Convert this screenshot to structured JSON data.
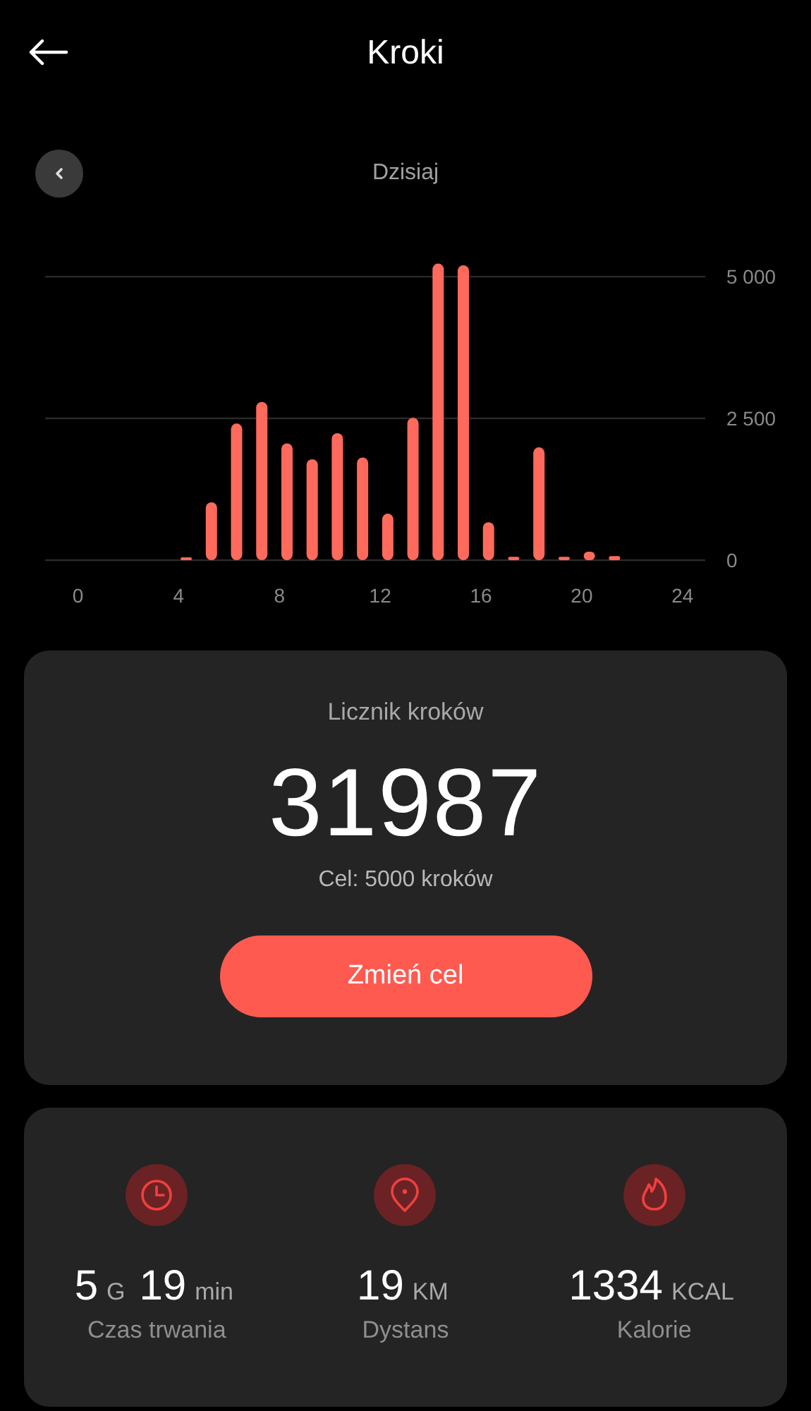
{
  "header": {
    "title": "Kroki"
  },
  "period": {
    "label": "Dzisiaj"
  },
  "chart_data": {
    "type": "bar",
    "x": [
      4.3,
      5.3,
      6.3,
      7.3,
      8.3,
      9.3,
      10.3,
      11.3,
      12.3,
      13.3,
      14.3,
      15.3,
      16.3,
      17.3,
      18.3,
      19.3,
      20.3,
      21.3
    ],
    "series": [
      {
        "color": "#ff6a5c",
        "values": [
          20,
          1020,
          2410,
          2790,
          2060,
          1780,
          2240,
          1810,
          820,
          2510,
          5230,
          5200,
          670,
          60,
          1990,
          60,
          150,
          70
        ]
      }
    ],
    "xlim": [
      -1.3,
      24.9
    ],
    "ylim": [
      0,
      5250
    ],
    "xticks": [
      0,
      4,
      8,
      12,
      16,
      20,
      24
    ],
    "yticks": [
      {
        "value": 0,
        "label": "0"
      },
      {
        "value": 2500,
        "label": "2 500"
      },
      {
        "value": 5000,
        "label": "5 000"
      }
    ]
  },
  "counter": {
    "title": "Licznik kroków",
    "value": "31987",
    "goal": "Cel: 5000 kroków",
    "button": "Zmień cel"
  },
  "stats": [
    {
      "kind": "time",
      "parts": [
        {
          "number": "5",
          "unit": "G"
        },
        {
          "number": "19",
          "unit": "min"
        }
      ],
      "label": "Czas trwania"
    },
    {
      "kind": "distance",
      "parts": [
        {
          "number": "19",
          "unit": "KM"
        }
      ],
      "label": "Dystans"
    },
    {
      "kind": "calories",
      "parts": [
        {
          "number": "1334",
          "unit": "KCAL"
        }
      ],
      "label": "Kalorie"
    }
  ]
}
